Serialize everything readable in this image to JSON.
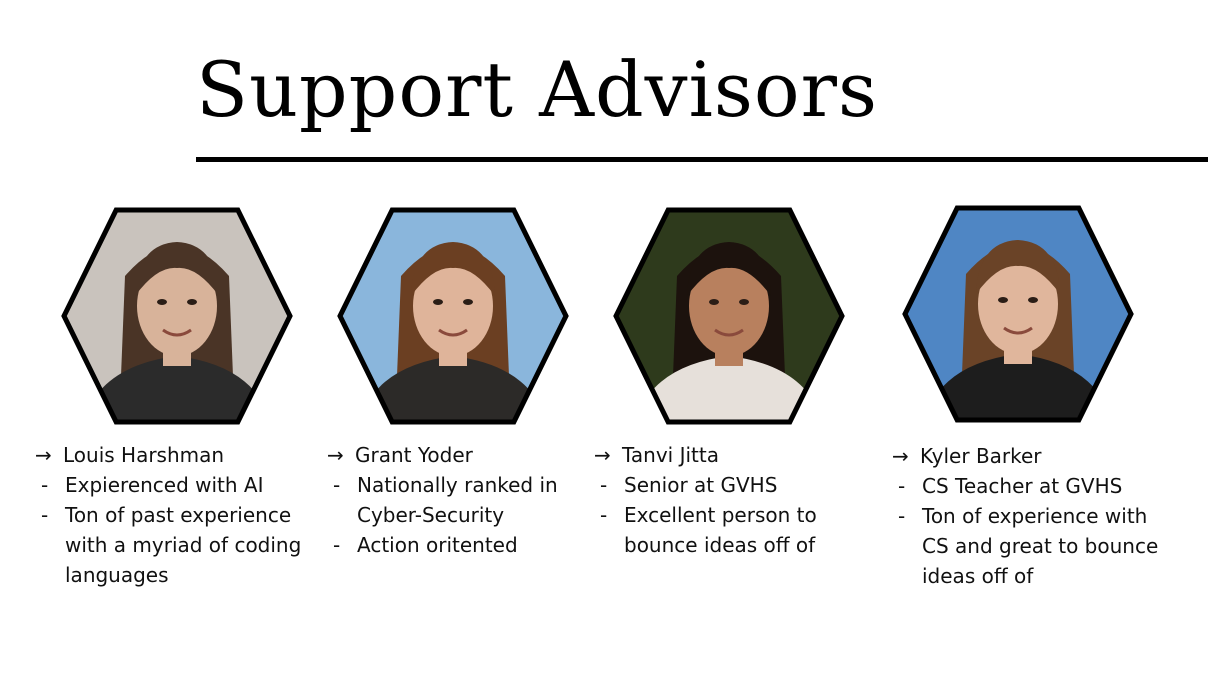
{
  "slide": {
    "title": "Support Advisors"
  },
  "advisors": [
    {
      "name": "Louis Harshman",
      "bullets": [
        "Expierenced with AI",
        "Ton of past experience",
        "with a myriad of coding",
        "languages"
      ],
      "photo_bg": "#c9c3bd",
      "hair": "#4a3426",
      "skin": "#d8b39a",
      "clothes": "#2b2b2b"
    },
    {
      "name": "Grant Yoder",
      "bullets": [
        "Nationally ranked in",
        "Cyber-Security",
        "Action oritented"
      ],
      "photo_bg": "#8ab6dc",
      "hair": "#6b3f22",
      "skin": "#dfb49a",
      "clothes": "#2c2a28"
    },
    {
      "name": "Tanvi Jitta",
      "bullets": [
        "Senior at GVHS",
        "Excellent person to",
        "bounce ideas off of"
      ],
      "photo_bg": "#2e3a1c",
      "hair": "#1c120d",
      "skin": "#b8805e",
      "clothes": "#e6e0da"
    },
    {
      "name": "Kyler Barker",
      "bullets": [
        "CS Teacher at GVHS",
        "Ton of experience with",
        "CS and great to bounce",
        "ideas off of"
      ],
      "photo_bg": "#4f86c4",
      "hair": "#6a4327",
      "skin": "#e0b69c",
      "clothes": "#1d1d1d"
    }
  ],
  "glyphs": {
    "arrow": "→",
    "dash": "-"
  }
}
